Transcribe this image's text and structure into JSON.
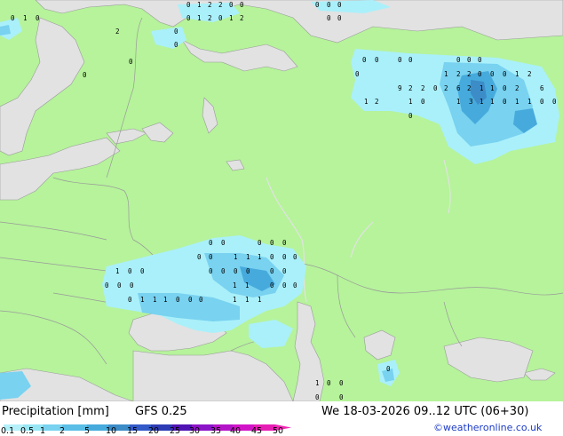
{
  "footer": {
    "title": "Precipitation [mm]",
    "model": "GFS 0.25",
    "datetime": "We 18-03-2026 09..12 UTC (06+30)",
    "credit": "©weatheronline.co.uk"
  },
  "legend": {
    "ticks": [
      "0.1",
      "0.5",
      "1",
      "2",
      "5",
      "10",
      "15",
      "20",
      "25",
      "30",
      "35",
      "40",
      "45",
      "50"
    ],
    "colors": [
      "#b4f0fa",
      "#96e6f5",
      "#78d2f0",
      "#5abee6",
      "#46aadc",
      "#3c8cc8",
      "#325ac8",
      "#2d3cb4",
      "#5014b4",
      "#8c14c8",
      "#b414c8",
      "#d214c8",
      "#e61eb4",
      "#f028b4"
    ]
  },
  "map_colors": {
    "land": "#b6f39b",
    "sea": "#e2e2e2",
    "border": "#9a9a9a",
    "light_precip": "#aaf0fa",
    "medium_precip": "#78d2f0",
    "heavy_precip": "#3c8cc8"
  },
  "value_labels": [
    {
      "group": "nw",
      "values": [
        "0",
        "1",
        "0"
      ]
    },
    {
      "group": "n",
      "values": [
        "0",
        "1",
        "2",
        "2",
        "0",
        "0",
        "0",
        "1",
        "2",
        "0",
        "1",
        "2",
        "2",
        "0",
        "0",
        "0",
        "0",
        "0",
        "0",
        "0",
        "0",
        "0"
      ]
    },
    {
      "group": "ural",
      "values": [
        "0",
        "0",
        "0",
        "0",
        "0",
        "0",
        "0",
        "0",
        "1",
        "2",
        "2",
        "0",
        "0",
        "0",
        "1",
        "2",
        "9",
        "2",
        "2",
        "0",
        "2",
        "6",
        "2",
        "1",
        "1",
        "0",
        "2",
        "6",
        "1",
        "2",
        "1",
        "0",
        "1",
        "3",
        "1",
        "1",
        "0",
        "1",
        "1",
        "0",
        "0",
        "0"
      ]
    },
    {
      "group": "south",
      "values": [
        "0",
        "0",
        "0",
        "0",
        "0",
        "0",
        "0",
        "1",
        "1",
        "1",
        "0",
        "0",
        "0",
        "1",
        "0",
        "0",
        "0",
        "0",
        "0",
        "0",
        "0",
        "0",
        "0",
        "0",
        "0",
        "1",
        "1",
        "0",
        "0",
        "0",
        "0",
        "1",
        "1",
        "1",
        "0",
        "0",
        "0",
        "1",
        "1",
        "1"
      ]
    },
    {
      "group": "caspian",
      "values": [
        "0",
        "1",
        "0",
        "0",
        "0",
        "0"
      ]
    }
  ]
}
